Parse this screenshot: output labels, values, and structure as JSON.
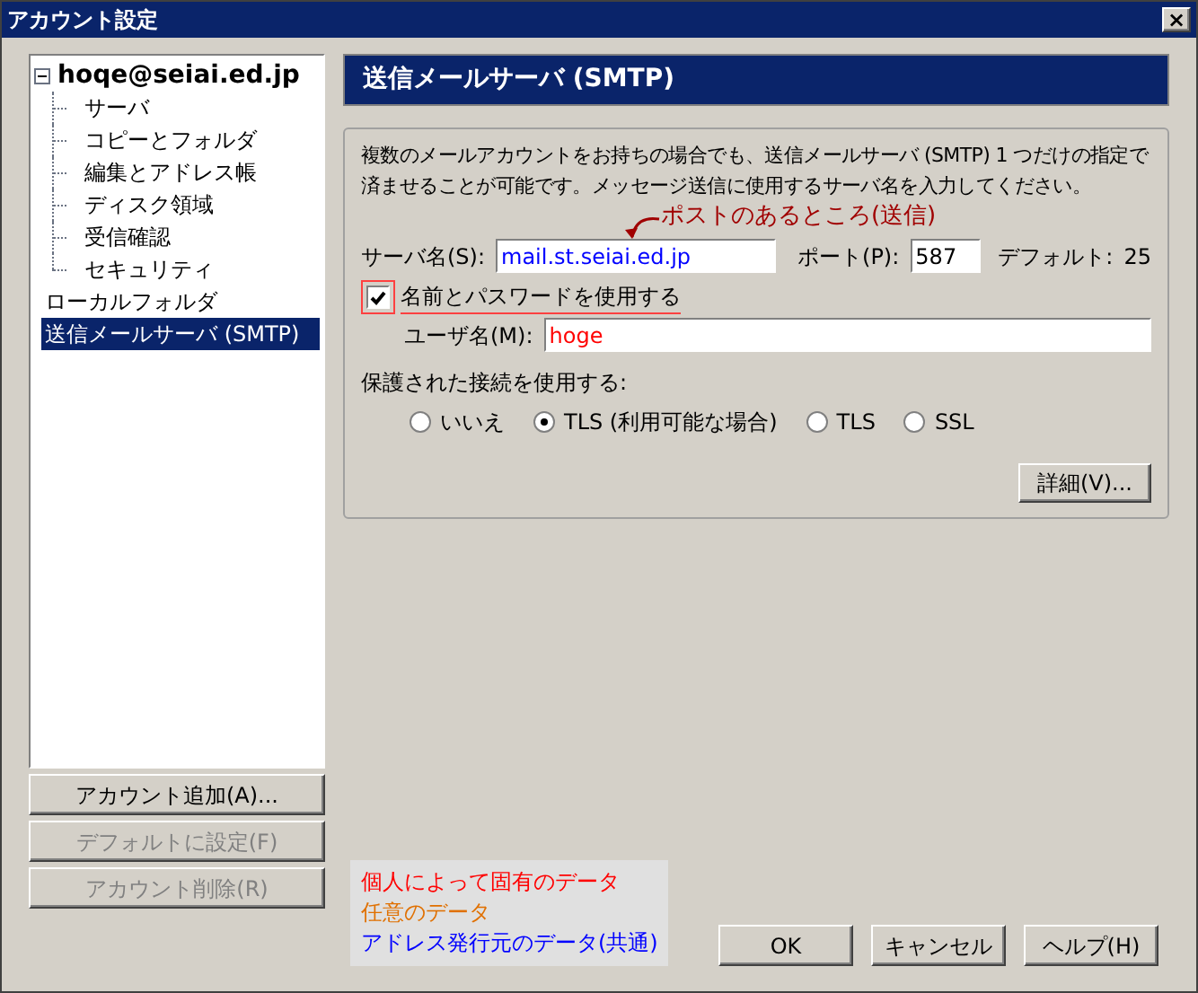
{
  "window": {
    "title": "アカウント設定",
    "close": "×"
  },
  "tree": {
    "items": [
      {
        "label": "hoqe@seiai.ed.jp",
        "expanded": true,
        "selected": false,
        "children": [
          {
            "label": "サーバ",
            "selected": false
          },
          {
            "label": "コピーとフォルダ",
            "selected": false
          },
          {
            "label": "編集とアドレス帳",
            "selected": false
          },
          {
            "label": "ディスク領域",
            "selected": false
          },
          {
            "label": "受信確認",
            "selected": false
          },
          {
            "label": "セキュリティ",
            "selected": false
          }
        ]
      },
      {
        "label": "ローカルフォルダ",
        "selected": false
      },
      {
        "label": "送信メールサーバ (SMTP)",
        "selected": true
      }
    ]
  },
  "account_buttons": [
    {
      "label": "アカウント追加(A)...",
      "disabled": false
    },
    {
      "label": "デフォルトに設定(F)",
      "disabled": true
    },
    {
      "label": "アカウント削除(R)",
      "disabled": true
    }
  ],
  "panel": {
    "title": "送信メールサーバ (SMTP)",
    "description": "複数のメールアカウントをお持ちの場合でも、送信メールサーバ (SMTP) 1 つだけの指定で済ませることが可能です。メッセージ送信に使用するサーバ名を入力してください。",
    "annotation": "ポストのあるところ(送信)",
    "server": {
      "label": "サーバ名(S):",
      "value": "mail.st.seiai.ed.jp",
      "color": "#0000ff"
    },
    "port": {
      "label": "ポート(P):",
      "value": "587",
      "color": "#000000"
    },
    "default_port": {
      "label": "デフォルト:",
      "value": "25"
    },
    "use_password": {
      "label": "名前とパスワードを使用する",
      "checked": true
    },
    "username": {
      "label": "ユーザ名(M):",
      "value": "hoge",
      "color": "#ff0000"
    },
    "secure_label": "保護された接続を使用する:",
    "secure_options": [
      {
        "label": "いいえ",
        "selected": false
      },
      {
        "label": "TLS (利用可能な場合)",
        "selected": true
      },
      {
        "label": "TLS",
        "selected": false
      },
      {
        "label": "SSL",
        "selected": false
      }
    ],
    "advanced_button": "詳細(V)..."
  },
  "legend": [
    {
      "label": "個人によって固有のデータ",
      "color": "#ff0000"
    },
    {
      "label": "任意のデータ",
      "color": "#e07000"
    },
    {
      "label": "アドレス発行元のデータ(共通)",
      "color": "#0000ff"
    }
  ],
  "dialog_buttons": [
    "OK",
    "キャンセル",
    "ヘルプ(H)"
  ]
}
